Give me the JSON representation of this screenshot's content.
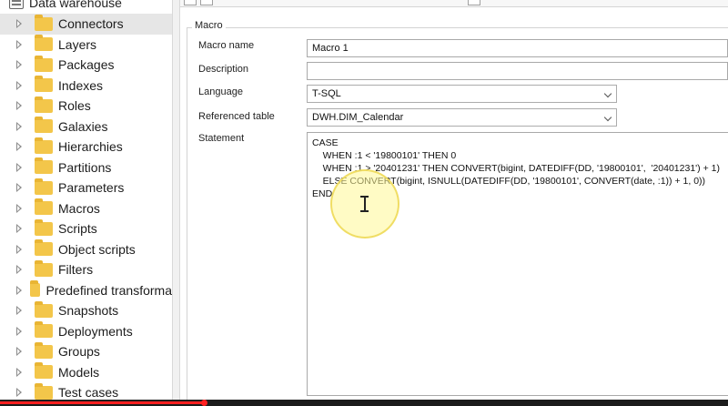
{
  "tree": {
    "root_label": "Data warehouse",
    "items": [
      {
        "label": "Connectors",
        "selected": true
      },
      {
        "label": "Layers",
        "selected": false
      },
      {
        "label": "Packages",
        "selected": false
      },
      {
        "label": "Indexes",
        "selected": false
      },
      {
        "label": "Roles",
        "selected": false
      },
      {
        "label": "Galaxies",
        "selected": false
      },
      {
        "label": "Hierarchies",
        "selected": false
      },
      {
        "label": "Partitions",
        "selected": false
      },
      {
        "label": "Parameters",
        "selected": false
      },
      {
        "label": "Macros",
        "selected": false
      },
      {
        "label": "Scripts",
        "selected": false
      },
      {
        "label": "Object scripts",
        "selected": false
      },
      {
        "label": "Filters",
        "selected": false
      },
      {
        "label": "Predefined transforma",
        "selected": false
      },
      {
        "label": "Snapshots",
        "selected": false
      },
      {
        "label": "Deployments",
        "selected": false
      },
      {
        "label": "Groups",
        "selected": false
      },
      {
        "label": "Models",
        "selected": false
      },
      {
        "label": "Test cases",
        "selected": false
      }
    ]
  },
  "form": {
    "group_title": "Macro",
    "macro_name_label": "Macro name",
    "macro_name_value": "Macro 1",
    "description_label": "Description",
    "description_value": "",
    "language_label": "Language",
    "language_value": "T-SQL",
    "referenced_table_label": "Referenced table",
    "referenced_table_value": "DWH.DIM_Calendar",
    "statement_label": "Statement",
    "statement_lines": [
      "CASE",
      "    WHEN :1 < '19800101' THEN 0",
      "    WHEN :1 > '20401231' THEN CONVERT(bigint, DATEDIFF(DD, '19800101',  '20401231') + 1)",
      "    ELSE CONVERT(bigint, ISNULL(DATEDIFF(DD, '19800101', CONVERT(date, :1)) + 1, 0))",
      "END"
    ]
  },
  "video_progress": {
    "fraction": 0.28
  }
}
